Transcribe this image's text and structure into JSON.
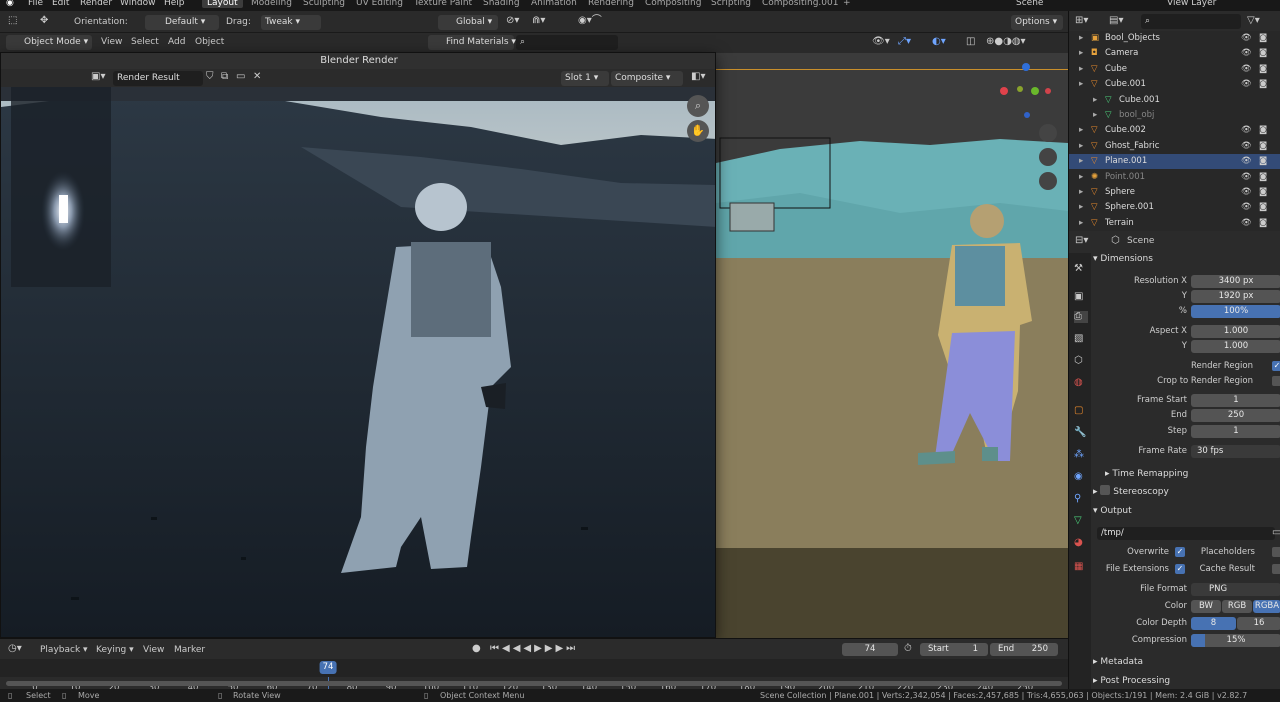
{
  "topbar": {
    "menus": [
      "File",
      "Edit",
      "Render",
      "Window",
      "Help"
    ],
    "workspaces": [
      "Layout",
      "Modeling",
      "Sculpting",
      "UV Editing",
      "Texture Paint",
      "Shading",
      "Animation",
      "Rendering",
      "Compositing",
      "Scripting",
      "Compositing.001"
    ],
    "add_tab": "+",
    "scene": "Scene",
    "view_layer": "View Layer"
  },
  "header": {
    "orientation_label": "Orientation:",
    "orientation_value": "Default",
    "drag_label": "Drag:",
    "drag_value": "Tweak",
    "transform_orientation": "Global",
    "options": "Options"
  },
  "header2": {
    "mode": "Object Mode",
    "menu": [
      "View",
      "Select",
      "Add",
      "Object"
    ],
    "find_materials": "Find Materials"
  },
  "render_window": {
    "title": "Blender Render",
    "image_name": "Render Result",
    "slot": "Slot 1",
    "pass": "Composite"
  },
  "outliner": {
    "items": [
      {
        "name": "Bool_Objects",
        "icon": "collection-icon",
        "indent": 0,
        "selected": false,
        "dim": false
      },
      {
        "name": "Camera",
        "icon": "camera-icon",
        "indent": 0,
        "selected": false,
        "dim": false
      },
      {
        "name": "Cube",
        "icon": "mesh-icon",
        "indent": 0,
        "selected": false,
        "dim": false
      },
      {
        "name": "Cube.001",
        "icon": "mesh-icon",
        "indent": 0,
        "selected": false,
        "dim": false
      },
      {
        "name": "Cube.001",
        "icon": "mesh-data-icon",
        "indent": 1,
        "selected": false,
        "dim": false
      },
      {
        "name": "bool_obj",
        "icon": "mesh-data-icon",
        "indent": 1,
        "selected": false,
        "dim": true
      },
      {
        "name": "Cube.002",
        "icon": "mesh-icon",
        "indent": 0,
        "selected": false,
        "dim": false
      },
      {
        "name": "Ghost_Fabric",
        "icon": "mesh-icon",
        "indent": 0,
        "selected": false,
        "dim": false
      },
      {
        "name": "Plane.001",
        "icon": "mesh-icon",
        "indent": 0,
        "selected": true,
        "dim": false
      },
      {
        "name": "Point.001",
        "icon": "light-icon",
        "indent": 0,
        "selected": false,
        "dim": true
      },
      {
        "name": "Sphere",
        "icon": "mesh-icon",
        "indent": 0,
        "selected": false,
        "dim": false
      },
      {
        "name": "Sphere.001",
        "icon": "mesh-icon",
        "indent": 0,
        "selected": false,
        "dim": false
      },
      {
        "name": "Terrain",
        "icon": "mesh-icon",
        "indent": 0,
        "selected": false,
        "dim": false
      }
    ]
  },
  "properties": {
    "scene_name": "Scene",
    "dimensions": {
      "title": "Dimensions",
      "res_x_label": "Resolution X",
      "res_x": "3400 px",
      "res_y_label": "Y",
      "res_y": "1920 px",
      "pct_label": "%",
      "pct": "100%",
      "aspect_x_label": "Aspect X",
      "aspect_x": "1.000",
      "aspect_y_label": "Y",
      "aspect_y": "1.000",
      "render_region": "Render Region",
      "crop": "Crop to Render Region",
      "frame_start_label": "Frame Start",
      "frame_start": "1",
      "end_label": "End",
      "end": "250",
      "step_label": "Step",
      "step": "1",
      "frame_rate_label": "Frame Rate",
      "frame_rate": "30 fps",
      "time_remapping": "Time Remapping"
    },
    "stereoscopy": "Stereoscopy",
    "output": {
      "title": "Output",
      "path": "/tmp/",
      "overwrite": "Overwrite",
      "placeholders": "Placeholders",
      "file_extensions": "File Extensions",
      "cache_result": "Cache Result",
      "file_format_label": "File Format",
      "file_format": "PNG",
      "color_label": "Color",
      "color_options": [
        "BW",
        "RGB",
        "RGBA"
      ],
      "color_depth_label": "Color Depth",
      "depth_options": [
        "8",
        "16"
      ],
      "compression_label": "Compression",
      "compression": "15%",
      "compression_fraction": 0.15
    },
    "metadata": "Metadata",
    "post_processing": "Post Processing"
  },
  "timeline": {
    "menus": [
      "Playback",
      "Keying",
      "View",
      "Marker"
    ],
    "current_frame": "74",
    "start_label": "Start",
    "start": "1",
    "end_label": "End",
    "end": "250",
    "ticks": [
      "0",
      "10",
      "20",
      "30",
      "40",
      "50",
      "60",
      "70",
      "74",
      "80",
      "90",
      "100",
      "110",
      "120",
      "130",
      "140",
      "150",
      "160",
      "170",
      "180",
      "190",
      "200",
      "210",
      "220",
      "230",
      "240",
      "250"
    ]
  },
  "status": {
    "select": "Select",
    "move": "Move",
    "rotate": "Rotate View",
    "context": "Object Context Menu",
    "stats": "Scene Collection | Plane.001 | Verts:2,342,054 | Faces:2,457,685 | Tris:4,655,063 | Objects:1/191 | Mem: 2.4 GiB | v2.82.7"
  }
}
